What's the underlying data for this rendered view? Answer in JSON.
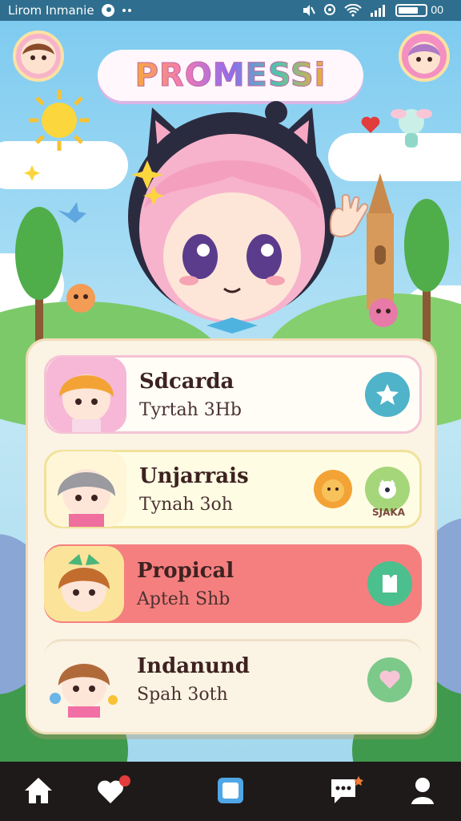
{
  "status_bar": {
    "title": "Lirom Inmanie",
    "battery_level": 0.75,
    "battery_label": "00"
  },
  "header": {
    "logo_text": "PROMESSi"
  },
  "list": {
    "items": [
      {
        "name": "Sdcarda",
        "subtitle": "Tyrtah 3Hb",
        "action_icon": "star-icon",
        "action_color": "#4fb3c9",
        "row_color": "#fffdf6"
      },
      {
        "name": "Unjarrais",
        "subtitle": "Tynah 3oh",
        "action_icon": "cat-face-icon",
        "action_color": "#a5d67a",
        "row_color": "#fffce4",
        "tag": "SJAKA"
      },
      {
        "name": "Propical",
        "subtitle": "Apteh Shb",
        "action_icon": "shirt-icon",
        "action_color": "#4cbf8e",
        "row_color": "#f57f7f"
      },
      {
        "name": "Indanund",
        "subtitle": "Spah 3oth",
        "action_icon": "heart-icon",
        "action_color": "#7cc98a",
        "row_color": "#fbf3e4"
      }
    ]
  },
  "nav": {
    "items": [
      {
        "icon": "home-icon"
      },
      {
        "icon": "heart-notification-icon"
      },
      {
        "icon": "square-icon"
      },
      {
        "icon": "chat-icon"
      },
      {
        "icon": "profile-icon"
      }
    ]
  }
}
